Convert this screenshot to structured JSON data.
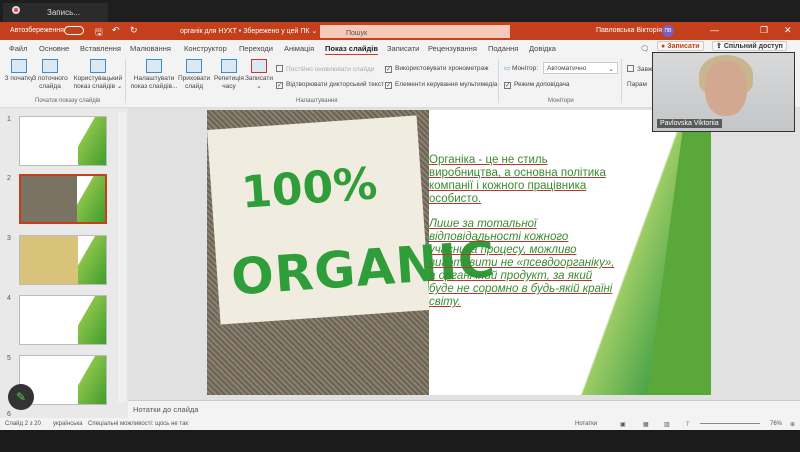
{
  "recorder": {
    "tab_label": "Запись..."
  },
  "titlebar": {
    "autosave": "Автозбереження",
    "doc_title": "органік для НУХТ • Збережено у цей ПК ⌄",
    "search_placeholder": "Пошук",
    "user": "Павловська Вікторія",
    "initials": "ПВ"
  },
  "menu": [
    "Файл",
    "Основне",
    "Вставлення",
    "Малювання",
    "Конструктор",
    "Переходи",
    "Анімація",
    "Показ слайдів",
    "Записати",
    "Рецензування",
    "Подання",
    "Довідка"
  ],
  "menu_right": {
    "record": "Записати",
    "share": "Спільний доступ"
  },
  "ribbon": {
    "from_start": "З початку",
    "from_current": "З поточного слайда",
    "custom": "Користувацький показ слайдів ⌄",
    "group_start": "Початок показу слайдів",
    "setup": "Налаштувати показ слайдів...",
    "hide": "Приховати слайд",
    "rehearse": "Репетиція часу",
    "record": "Записати ⌄",
    "keep_updated": "Постійно оновлювати слайди",
    "play_narration": "Відтворювати дикторський текст",
    "use_timings": "Використовувати хронометраж",
    "media_controls": "Елементи керування мультимедіа",
    "group_setup": "Налаштування",
    "monitor_label": "Монітор:",
    "monitor_value": "Автоматично",
    "presenter_view": "Режим доповідача",
    "group_monitors": "Монітори",
    "always": "Завжд",
    "params": "Парам"
  },
  "thumbnails": [
    "1",
    "2",
    "3",
    "4",
    "5",
    "6"
  ],
  "slide": {
    "stamp_top": "100%",
    "stamp_bottom": "ORGANIC",
    "para1": "Органіка - це не стиль виробництва, а основна політика компанії і кожного працівника особисто.",
    "para2": "Лише за тотальної відповідальності кожного учасника процесу, можливо виготовити не «псевдоорганіку», а органічний продукт, за який буде не соромно в будь-якій країні світу."
  },
  "notes_placeholder": "Нотатки до слайда",
  "status": {
    "slide": "Слайд 2 з 20",
    "language": "українська",
    "accessibility": "Спеціальні можливості: щось не так",
    "notes": "Нотатки",
    "zoom": "76%"
  },
  "webcam": {
    "name": "Pavlovska Viktoriia"
  }
}
